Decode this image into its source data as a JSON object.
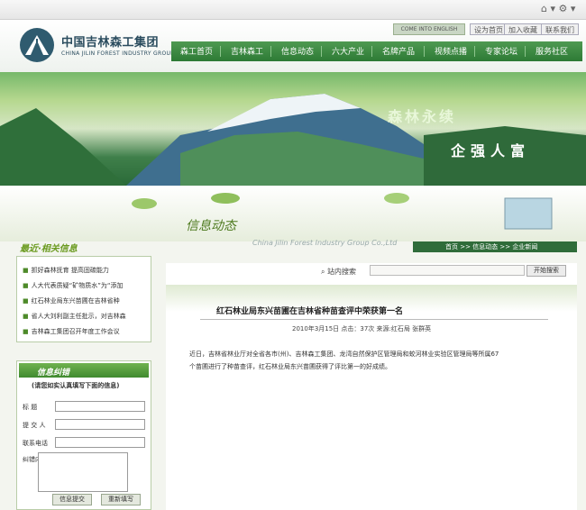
{
  "browser": {
    "tools_label": "⌂ ▾ ⚙ ▾"
  },
  "header": {
    "logo_cn": "中国吉林森工集团",
    "logo_en": "CHINA JILIN FOREST INDUSTRY GROUP",
    "english_link": "COME INTO ENGLISH",
    "top_links": [
      "设为首页",
      "加入收藏",
      "联系我们"
    ]
  },
  "nav": {
    "items": [
      "森工首页",
      "吉林森工",
      "信息动态",
      "六大产业",
      "名牌产品",
      "视频点播",
      "专家论坛",
      "服务社区"
    ]
  },
  "banner": {
    "slogan1": "森林永续",
    "slogan2": "企强人富"
  },
  "section": {
    "title": "信息动态",
    "subtitle_en": "China Jilin Forest Industry Group Co.,Ltd",
    "breadcrumb": "首页 >> 信息动态 >> 企业新闻"
  },
  "related": {
    "title": "最近·相关信息",
    "items": [
      "抓好森林抚育 提高固碳能力",
      "人大代表质疑“矿物质水”为“添加",
      "红石林业局东兴苗圃在吉林省种",
      "省人大刘利副主任批示，对吉林森",
      "吉林森工集团召开年度工作会议"
    ]
  },
  "feedback": {
    "title": "信息纠错",
    "note": "(请您如实认真填写下面的信息)",
    "labels": [
      "标  题",
      "提 交 人",
      "联系电话",
      "纠错内容"
    ],
    "submit_label": "信息提交",
    "reset_label": "重新填写"
  },
  "search": {
    "label": "站内搜索",
    "button": "开始搜索"
  },
  "article": {
    "title": "红石林业局东兴苗圃在吉林省种苗查评中荣获第一名",
    "meta": "2010年3月15日  点击：37次  来源:红石局 张群英",
    "body_line1": "近日，吉林省林业厅对全省各市(州)、吉林森工集团、龙湾自然保护区管理局和蛟河林业实验区管理局等所属67",
    "body_line2": "个苗圃进行了种苗查评，红石林业局东兴苗圃获得了评比第一的好成绩。"
  },
  "colors": {
    "nav_green": "#2d7a35",
    "accent_text": "#4e7a1f"
  }
}
